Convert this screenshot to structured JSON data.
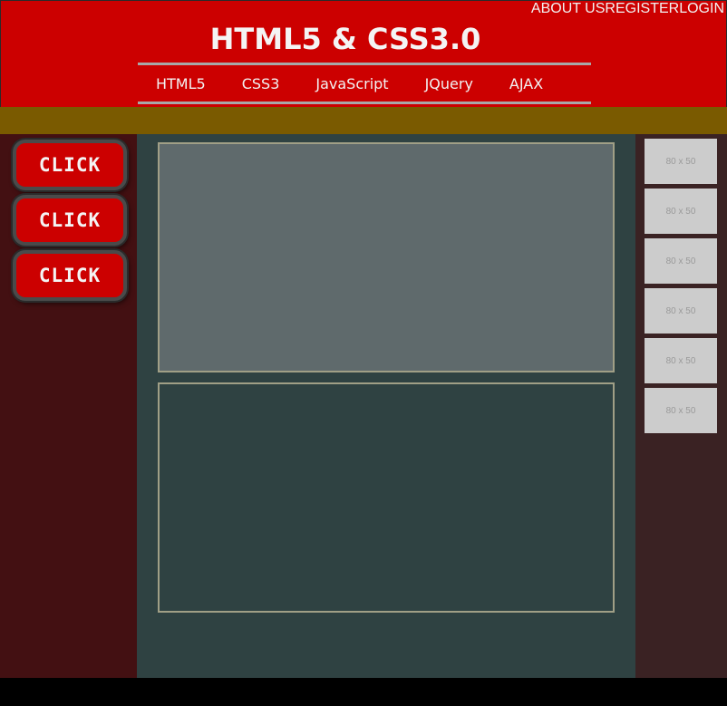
{
  "header": {
    "top_links": [
      "ABOUT US",
      "REGISTER",
      "LOGIN"
    ],
    "title": "HTML5 & CSS3.0",
    "nav": [
      "HTML5",
      "CSS3",
      "JavaScript",
      "JQuery",
      "AJAX"
    ]
  },
  "left": {
    "buttons": [
      "CLICK",
      "CLICK",
      "CLICK"
    ]
  },
  "right": {
    "thumbnails": [
      "80 x 50",
      "80 x 50",
      "80 x 50",
      "80 x 50",
      "80 x 50",
      "80 x 50"
    ]
  },
  "colors": {
    "header": "#cc0000",
    "band": "#7a5a00",
    "left_sidebar": "#431012",
    "main": "#2f4242",
    "right_sidebar": "#3a2223"
  }
}
